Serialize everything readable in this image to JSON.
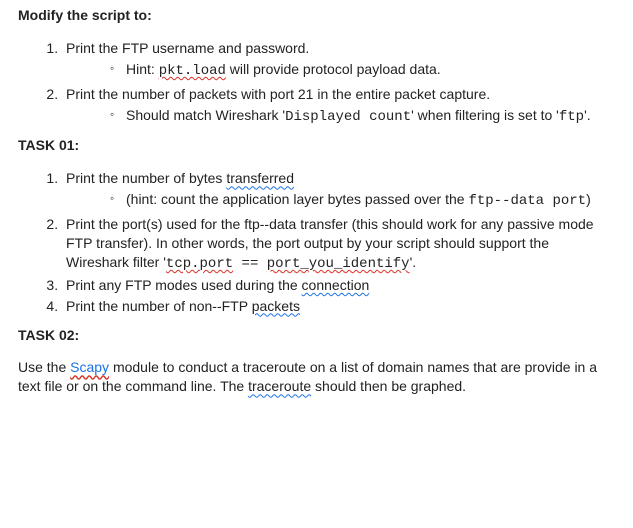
{
  "heading_main": "Modify the script to:",
  "s1": {
    "i1": {
      "text": "Print the FTP username and password."
    },
    "sub1": {
      "lead": "Hint: ",
      "code": "pkt.load",
      "rest": " will provide protocol payload data."
    },
    "i2": {
      "text": "Print the number of packets with port 21 in the entire packet capture."
    },
    "sub2": {
      "lead": "Should match Wireshark '",
      "code": "Displayed count",
      "mid": "' when filtering is set to '",
      "code2": "ftp",
      "end": "'."
    }
  },
  "task01_heading": "TASK 01:",
  "t1": {
    "i1": {
      "a": "Print the number of bytes ",
      "b": "transferred"
    },
    "sub1": {
      "a": "(hint: count the application layer bytes passed over the ",
      "code": "ftp-‐data port",
      "b": ")"
    },
    "i2": {
      "a": "Print the port(s) used for the ftp-‐data transfer (this should work for any passive mode FTP transfer). In other words, the port output by your script should support the Wireshark filter '",
      "code1": "tcp.port",
      "mid": " == ",
      "code2": "port_you_identify",
      "end": "'."
    },
    "i3": {
      "a": "Print any FTP modes used during the ",
      "b": "connection"
    },
    "i4": {
      "a": "Print the number of non-‐FTP ",
      "b": "packets"
    }
  },
  "task02_heading": "TASK 02:",
  "t2": {
    "a": "Use the ",
    "scapy": "Scapy",
    "b": " module to conduct a traceroute on a list of domain names that are provide in a text file or on the command line. The ",
    "traceroute": "traceroute",
    "c": " should then be graphed."
  }
}
